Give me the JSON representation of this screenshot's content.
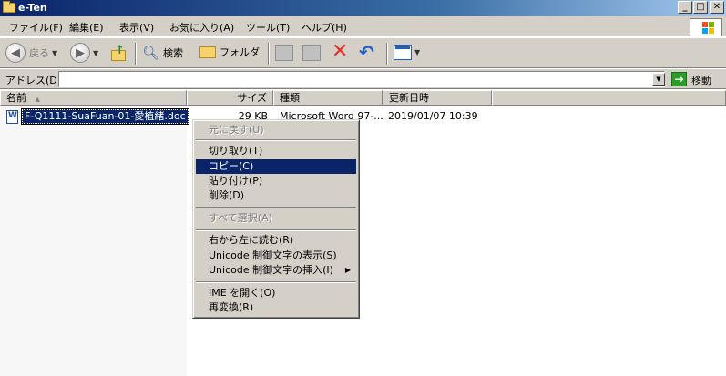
{
  "window": {
    "title": "e-Ten"
  },
  "menubar": {
    "items": [
      "ファイル(F)",
      "編集(E)",
      "表示(V)",
      "お気に入り(A)",
      "ツール(T)",
      "ヘルプ(H)"
    ]
  },
  "toolbar": {
    "back_label": "戻る",
    "search_label": "検索",
    "folder_label": "フォルダ"
  },
  "address": {
    "label": "アドレス(D)",
    "value": "",
    "go_label": "移動"
  },
  "columns": {
    "name": "名前",
    "size": "サイズ",
    "type": "種類",
    "modified": "更新日時"
  },
  "files": [
    {
      "name": "F-Q1111-SuaFuan-01-愛植緒.doc",
      "size": "29 KB",
      "type": "Microsoft Word 97-...",
      "modified": "2019/01/07 10:39"
    }
  ],
  "context_menu": {
    "undo": "元に戻す(U)",
    "cut": "切り取り(T)",
    "copy": "コピー(C)",
    "paste": "貼り付け(P)",
    "delete": "削除(D)",
    "select_all": "すべて選択(A)",
    "rtl": "右から左に読む(R)",
    "unicode_show": "Unicode 制御文字の表示(S)",
    "unicode_insert": "Unicode 制御文字の挿入(I)",
    "ime_open": "IME を開く(O)",
    "reconvert": "再変換(R)"
  },
  "colors": {
    "selection": "#0a246a",
    "chrome": "#d4d0c8",
    "title_gradient_start": "#0a246a"
  }
}
